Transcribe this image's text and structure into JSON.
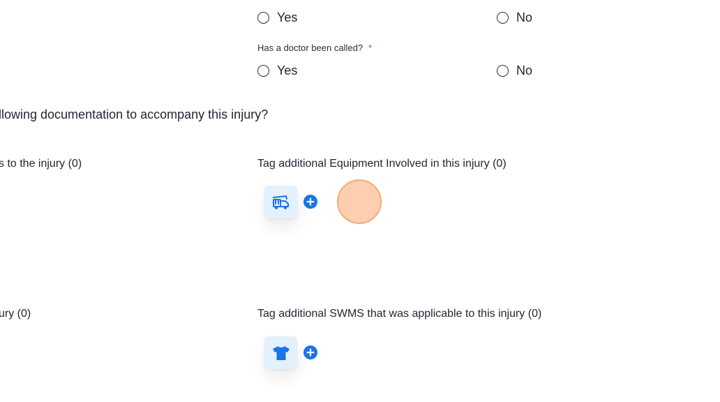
{
  "q1": {
    "yes_label": "Yes",
    "no_label": "No"
  },
  "q2": {
    "question": "Has a doctor been called?",
    "required_marker": "*",
    "yes_label": "Yes",
    "no_label": "No"
  },
  "documentation_heading": "llowing documentation to accompany this injury?",
  "left_col": {
    "tag1_label": "s to the injury (0)",
    "tag2_label": "ury (0)"
  },
  "equipment": {
    "label": "Tag additional Equipment Involved in this injury (0)",
    "icon": "crane-truck-icon",
    "add_icon": "plus-circle-icon"
  },
  "swms": {
    "label": "Tag additional SWMS that was applicable to this injury (0)",
    "icon": "shirt-icon",
    "add_icon": "plus-circle-icon"
  },
  "colors": {
    "accent": "#1a73e8",
    "tile_bg": "#e3f1fc",
    "required": "#e0443a",
    "cursor": "#fcbe96"
  }
}
